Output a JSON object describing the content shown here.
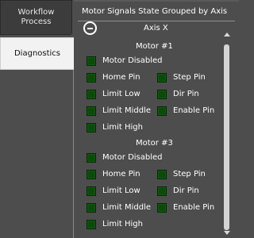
{
  "sidebar": {
    "tabs": [
      {
        "label_line1": "Workflow",
        "label_line2": "Process"
      },
      {
        "label_line1": "Diagnostics",
        "label_line2": ""
      }
    ]
  },
  "panel": {
    "title": "Motor Signals State Grouped by Axis",
    "axis_label": "Axis X",
    "motors": [
      {
        "title": "Motor #1",
        "signals": {
          "motor_disabled": "Motor Disabled",
          "home_pin": "Home Pin",
          "step_pin": "Step Pin",
          "limit_low": "Limit Low",
          "dir_pin": "Dir Pin",
          "limit_middle": "Limit Middle",
          "enable_pin": "Enable Pin",
          "limit_high": "Limit High"
        }
      },
      {
        "title": "Motor #3",
        "signals": {
          "motor_disabled": "Motor Disabled",
          "home_pin": "Home Pin",
          "step_pin": "Step Pin",
          "limit_low": "Limit Low",
          "dir_pin": "Dir Pin",
          "limit_middle": "Limit Middle",
          "enable_pin": "Enable Pin",
          "limit_high": "Limit High"
        }
      }
    ]
  },
  "colors": {
    "background": "#4d4d4d",
    "led_off": "#0b4a0b",
    "selected_tab": "#f2f2f2"
  }
}
